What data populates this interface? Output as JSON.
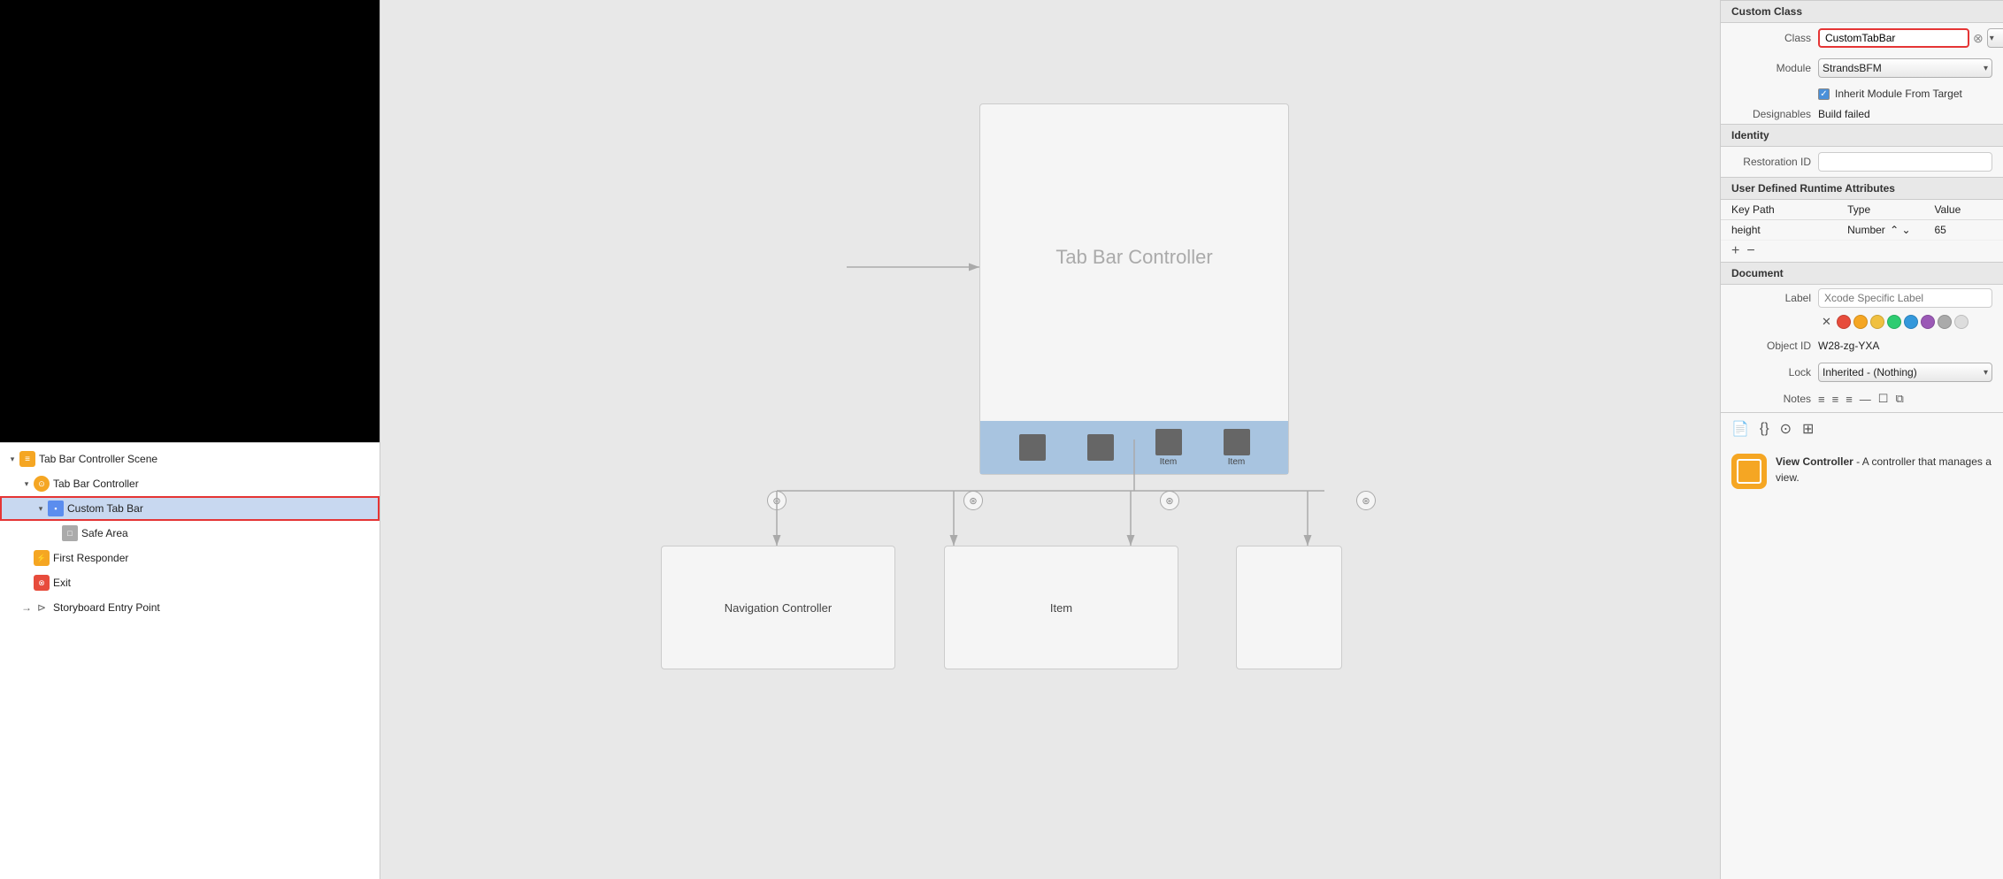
{
  "left": {
    "tree": {
      "items": [
        {
          "id": "scene-label",
          "level": 1,
          "indent": 1,
          "label": "Tab Bar Controller Scene",
          "icon": "scene",
          "expanded": true,
          "arrow": "▾"
        },
        {
          "id": "tabbar-ctrl",
          "level": 2,
          "indent": 2,
          "label": "Tab Bar Controller",
          "icon": "tabbar",
          "expanded": true,
          "arrow": "▾"
        },
        {
          "id": "custom-tabbar",
          "level": 3,
          "indent": 3,
          "label": "Custom Tab Bar",
          "icon": "custom",
          "expanded": false,
          "arrow": "▾",
          "selected": true,
          "highlighted": true
        },
        {
          "id": "safe-area",
          "level": 4,
          "indent": 4,
          "label": "Safe Area",
          "icon": "safe",
          "arrow": ""
        },
        {
          "id": "first-responder",
          "level": 2,
          "indent": 2,
          "label": "First Responder",
          "icon": "responder",
          "arrow": ""
        },
        {
          "id": "exit",
          "level": 2,
          "indent": 2,
          "label": "Exit",
          "icon": "exit",
          "arrow": ""
        },
        {
          "id": "storyboard-entry",
          "level": 2,
          "indent": 2,
          "label": "Storyboard Entry Point",
          "icon": "entry",
          "arrow": "→"
        }
      ]
    }
  },
  "canvas": {
    "tabbar_title": "Tab Bar Controller",
    "tab_items": [
      "",
      "",
      "",
      ""
    ],
    "tab_labels": [
      "",
      "",
      "Item",
      "Item"
    ],
    "nav_controller_label": "Navigation Controller",
    "item_controller_label": "Item"
  },
  "right": {
    "custom_class_section": "Custom Class",
    "class_label": "Class",
    "class_value": "CustomTabBar",
    "module_label": "Module",
    "module_value": "StrandsBFM",
    "inherit_label": "Inherit Module From Target",
    "designables_label": "Designables",
    "designables_value": "Build failed",
    "identity_section": "Identity",
    "restoration_id_label": "Restoration ID",
    "restoration_id_value": "",
    "runtime_section": "User Defined Runtime Attributes",
    "col_keypath": "Key Path",
    "col_type": "Type",
    "col_value": "Value",
    "row_keypath": "height",
    "row_type": "Number",
    "row_value": "65",
    "document_section": "Document",
    "doc_label_label": "Label",
    "doc_label_placeholder": "Xcode Specific Label",
    "object_id_label": "Object ID",
    "object_id_value": "W28-zg-YXA",
    "lock_label": "Lock",
    "lock_value": "Inherited - (Nothing)",
    "notes_label": "Notes",
    "colors": [
      "#e74c3c",
      "#f5a623",
      "#f0c040",
      "#2ecc71",
      "#3498db",
      "#9b59b6",
      "#aaa",
      "#ccc"
    ],
    "vc_title": "View Controller",
    "vc_desc": "- A controller that manages a view."
  }
}
